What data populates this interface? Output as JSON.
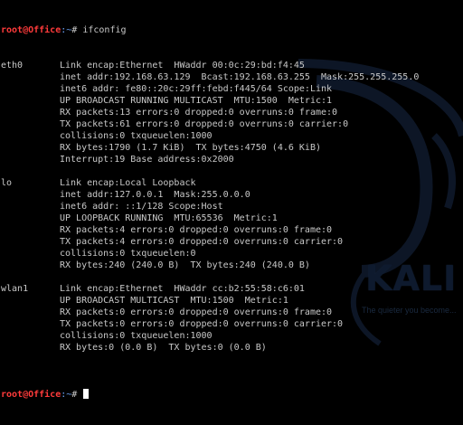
{
  "prompt": {
    "user_host": "root@Office",
    "path": ":~",
    "symbol": "#"
  },
  "command": "ifconfig",
  "interfaces": [
    {
      "name": "eth0",
      "lines": [
        "Link encap:Ethernet  HWaddr 00:0c:29:bd:f4:45",
        "inet addr:192.168.63.129  Bcast:192.168.63.255  Mask:255.255.255.0",
        "inet6 addr: fe80::20c:29ff:febd:f445/64 Scope:Link",
        "UP BROADCAST RUNNING MULTICAST  MTU:1500  Metric:1",
        "RX packets:13 errors:0 dropped:0 overruns:0 frame:0",
        "TX packets:61 errors:0 dropped:0 overruns:0 carrier:0",
        "collisions:0 txqueuelen:1000",
        "RX bytes:1790 (1.7 KiB)  TX bytes:4750 (4.6 KiB)",
        "Interrupt:19 Base address:0x2000"
      ]
    },
    {
      "name": "lo",
      "lines": [
        "Link encap:Local Loopback",
        "inet addr:127.0.0.1  Mask:255.0.0.0",
        "inet6 addr: ::1/128 Scope:Host",
        "UP LOOPBACK RUNNING  MTU:65536  Metric:1",
        "RX packets:4 errors:0 dropped:0 overruns:0 frame:0",
        "TX packets:4 errors:0 dropped:0 overruns:0 carrier:0",
        "collisions:0 txqueuelen:0",
        "RX bytes:240 (240.0 B)  TX bytes:240 (240.0 B)"
      ]
    },
    {
      "name": "wlan1",
      "lines": [
        "Link encap:Ethernet  HWaddr cc:b2:55:58:c6:01",
        "UP BROADCAST MULTICAST  MTU:1500  Metric:1",
        "RX packets:0 errors:0 dropped:0 overruns:0 frame:0",
        "TX packets:0 errors:0 dropped:0 overruns:0 carrier:0",
        "collisions:0 txqueuelen:1000",
        "RX bytes:0 (0.0 B)  TX bytes:0 (0.0 B)"
      ]
    }
  ],
  "watermark": {
    "logo": "KALI",
    "tagline": "The quieter you become..."
  },
  "colors": {
    "background": "#000000",
    "text": "#c8c8c8",
    "prompt_user": "#ff3b3b",
    "prompt_path": "#6ea8ff"
  }
}
